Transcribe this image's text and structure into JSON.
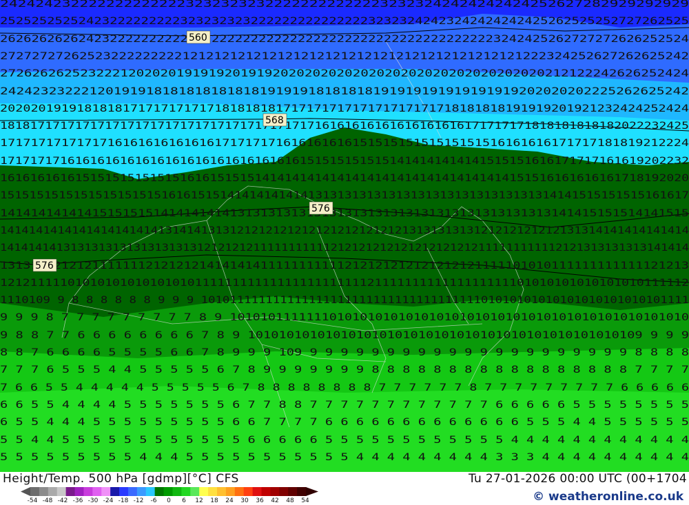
{
  "map": {
    "contour_labels": [
      "560",
      "568",
      "576",
      "576"
    ],
    "band_colors": {
      "deep_blue": "#1a2aff",
      "blue": "#2f6bff",
      "cyan_blue": "#1fb7ff",
      "cyan": "#1fe0ff",
      "dark_green": "#006400",
      "green": "#0a9a0a",
      "mid_green": "#14c814",
      "light_green": "#22dd22"
    },
    "grid_rows": [
      "242424232222222222222323232323222222222222232323242424242424252627282929292929",
      "2525252525242322222222232323232322222222222222232323242423242424242425262525252727262525",
      "2626262626242322222222222222222222222222222222222222222222222223242425262727272626252524",
      "272727272625232222222221212121212121212121212121212121212121212121222324252627262625242",
      "27262626252322212020201919192019192020202020202020202020202020202020212122242626252424",
      "2424232322212019191818181818181819191918181818191919191919191919202020202225262625242",
      "202020191918181817171717171718181818171717171717171717171718181818191919201921232424252424",
      "18181717171717171717171717171717171717171716161616161616161616171717171818181818182022232425",
      "171717171717171616161616161617171717161616161615151515151515151516161616171717181819212224",
      "17171717161616161616161616161616161616161515151515151414141414141515151616171717161619202232",
      "16161616161515151515151516161515151414141414141414141414141414141414151516161616161718192020",
      "1515151515151515151515161615151414141414141313131313131313131313131313131314141515151515161617",
      "141414141414151515151414141414131313131313131313131313131313131313131313141415151514141515",
      "141414141414141414141413141413131212121212121212121212121313131313121212121212131314141414141414",
      "14141414131313131313131313131212121211111111111212121212121212121212111111111112121313131313141414",
      "131312121212111111121212121414141411111111111212121212121212121111101010111111111111121213",
      "12121111101010101010101010111111111111111111111112111111111111111111101010101010101010111112",
      "1110109 9 8 8 8 8 8 8 9 9 9 10101111111111111111111111111111111111101010101010101010101010101111",
      "9 9 9 8 7 7 7 7 7 7 7 7 7 8 9 101010111111101010101010101010101010101010101010101010101010",
      "9 8 8 7 7 6 6 6 6 6 6 6 6 7 8 9 101010101010101010101010101010101010101010101010109 9 9 9",
      "8 8 7 6 6 6 6 5 5 5 5 6 6 7 8 9 9 9 109 9 9 9 9 9 9 9 9 9 9 9 9 9 9 9 9 9 9 9 9 9 8 8 8 8",
      "7 7 7 6 5 5 5 4 4 5 5 5 5 5 6 7 8 9 9 9 9 9 9 9 8 8 8 8 8 8 8 8 8 8 8 8 8 8 8 8 8 7 7 7 7",
      "7 6 6 5 5 4 4 4 4 4 5 5 5 5 5 6 7 8 8 8 8 8 8 8 8 7 7 7 7 7 7 8 7 7 7 7 7 7 7 7 7 6 6 6 6 6",
      "6 6 5 5 4 4 4 4 5 5 5 5 5 5 5 6 7 7 8 8 7 7 7 7 7 7 7 7 7 7 7 7 6 6 6 6 6 5 5 5 5 5 5 5 5",
      "6 5 5 4 4 4 5 5 5 5 5 5 5 5 5 6 6 7 7 7 7 6 6 6 6 6 6 6 6 6 6 6 6 6 5 5 5 4 4 5 5 5 5 5 5",
      "5 5 4 4 5 5 5 5 5 5 5 5 5 5 5 5 6 6 6 6 6 5 5 5 5 5 5 5 5 5 5 5 5 4 4 4 4 4 4 4 4 4 4 4 4",
      "5 5 5 5 5 5 5 5 5 4 4 4 5 5 5 5 5 5 5 5 5 5 5 4 4 4 4 4 4 4 4 4 3 3 3 4 4 4 4 4 4 4 4 4 4"
    ]
  },
  "footer": {
    "title": "Height/Temp. 500 hPa [gdmp][°C] CFS",
    "datetime": "Tu 27-01-2026 00:00 UTC (00+1704",
    "credit": "© weatheronline.co.uk",
    "colorbar_ticks": [
      "-54",
      "-48",
      "-42",
      "-36",
      "-30",
      "-24",
      "-18",
      "-12",
      "-6",
      "0",
      "6",
      "12",
      "18",
      "24",
      "30",
      "36",
      "42",
      "48",
      "54"
    ],
    "colorbar_colors": [
      "#6e6e6e",
      "#8c8c8c",
      "#aaaaaa",
      "#c8c8c8",
      "#7a1a8c",
      "#a020c0",
      "#c83cdc",
      "#e060f0",
      "#f090f8",
      "#1a1aaa",
      "#2a3aff",
      "#3a6aff",
      "#3a9aff",
      "#2ac8ff",
      "#007800",
      "#009a00",
      "#10b810",
      "#22d822",
      "#5ae85a",
      "#ffff50",
      "#ffe040",
      "#ffc030",
      "#ffa020",
      "#ff7010",
      "#ff4010",
      "#e01010",
      "#c00000",
      "#a00000",
      "#800000",
      "#600000",
      "#400000"
    ]
  }
}
